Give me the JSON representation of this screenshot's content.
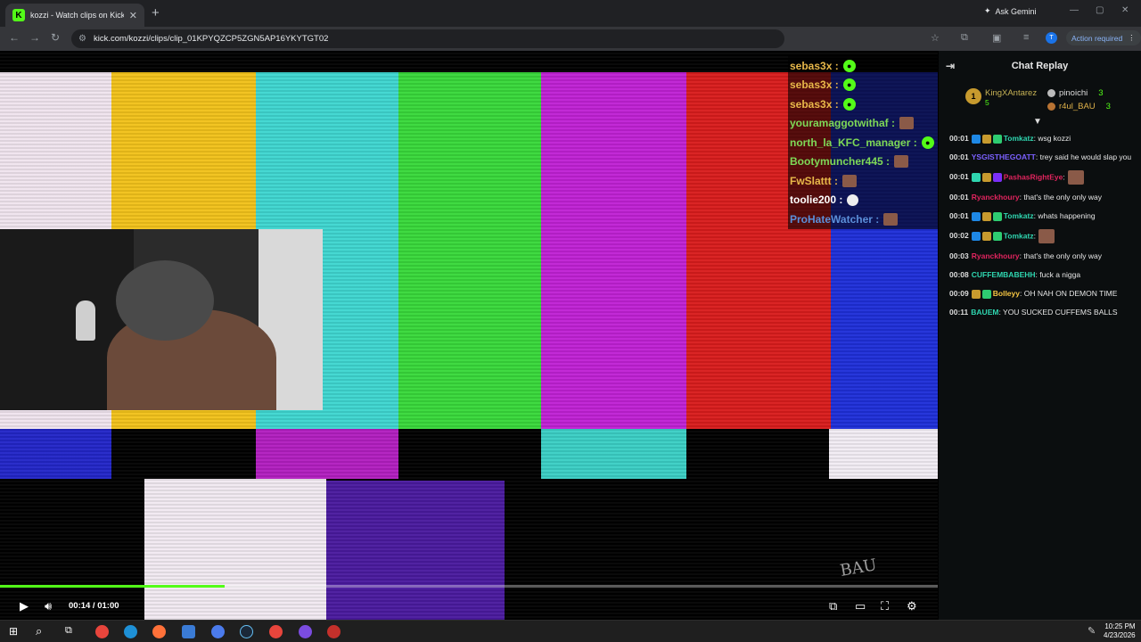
{
  "browser": {
    "tab_title": "kozzi - Watch clips on Kick",
    "url": "kick.com/kozzi/clips/clip_01KPYQZCP5ZGN5AP16YKYTGT02",
    "ask_gemini": "Ask Gemini",
    "action_required": "Action required",
    "profile_initial": "T"
  },
  "overlay_chat": [
    {
      "user": "sebas3x :",
      "color": "#e8b84a",
      "emote": "green"
    },
    {
      "user": "sebas3x :",
      "color": "#e8b84a",
      "emote": "green"
    },
    {
      "user": "sebas3x :",
      "color": "#e8b84a",
      "emote": "green"
    },
    {
      "user": "youramaggotwithaf :",
      "color": "#7ed957",
      "emote": "img"
    },
    {
      "user": "north_la_KFC_manager :",
      "color": "#7ed957",
      "emote": "green"
    },
    {
      "user": "Bootymuncher445 :",
      "color": "#7ed957",
      "emote": "img"
    },
    {
      "user": "FwSlattt :",
      "color": "#e8b84a",
      "emote": "img"
    },
    {
      "user": "toolie200 :",
      "color": "#ffffff",
      "emote": "skull"
    },
    {
      "user": "ProHateWatcher :",
      "color": "#5b8fd9",
      "emote": "img"
    }
  ],
  "player": {
    "current_time": "00:14",
    "duration": "01:00",
    "time_display": "00:14 / 01:00",
    "progress_fraction": 0.24
  },
  "chat_replay": {
    "title": "Chat Replay",
    "leaders": [
      {
        "rank": "1",
        "name": "KingXAntarez",
        "count": "5"
      },
      {
        "name": "pinoichi",
        "count": "3"
      },
      {
        "name": "r4ul_BAU",
        "count": "3"
      }
    ],
    "messages": [
      {
        "time": "00:01",
        "user": "Tomkatz",
        "color": "#2fd6b0",
        "text": ": wsg kozzi",
        "badges": [
          "#1e88e5",
          "#c79a2e",
          "#2ecc71"
        ]
      },
      {
        "time": "00:01",
        "user": "YSGISTHEGOATT",
        "color": "#7b61ff",
        "text": ": trey said he would slap you",
        "badges": []
      },
      {
        "time": "00:01",
        "user": "PashasRightEye",
        "color": "#e0245e",
        "text": ":",
        "badges": [
          "#2fd6b0",
          "#c79a2e",
          "#7b2ff7"
        ],
        "emote": true
      },
      {
        "time": "00:01",
        "user": "Ryanckhoury",
        "color": "#e0245e",
        "text": ": that's the only only way",
        "badges": []
      },
      {
        "time": "00:01",
        "user": "Tomkatz",
        "color": "#2fd6b0",
        "text": ": whats happening",
        "badges": [
          "#1e88e5",
          "#c79a2e",
          "#2ecc71"
        ]
      },
      {
        "time": "00:02",
        "user": "Tomkatz",
        "color": "#2fd6b0",
        "text": ":",
        "badges": [
          "#1e88e5",
          "#c79a2e",
          "#2ecc71"
        ],
        "emote": true
      },
      {
        "time": "00:03",
        "user": "Ryanckhoury",
        "color": "#e0245e",
        "text": ": that's the only only way",
        "badges": []
      },
      {
        "time": "00:08",
        "user": "CUFFEMBABEHH",
        "color": "#2fd6b0",
        "text": ": fuck a nigga",
        "badges": []
      },
      {
        "time": "00:09",
        "user": "Bolleyy",
        "color": "#f5c542",
        "text": ": OH NAH ON DEMON TIME",
        "badges": [
          "#c79a2e",
          "#2ecc71"
        ]
      },
      {
        "time": "00:11",
        "user": "BAUEM",
        "color": "#2fd6b0",
        "text": ": YOU SUCKED CUFFEMS BALLS",
        "badges": []
      }
    ]
  },
  "watermark_text": "BAU",
  "taskbar": {
    "time": "10:25 PM",
    "date": "4/23/2026"
  }
}
